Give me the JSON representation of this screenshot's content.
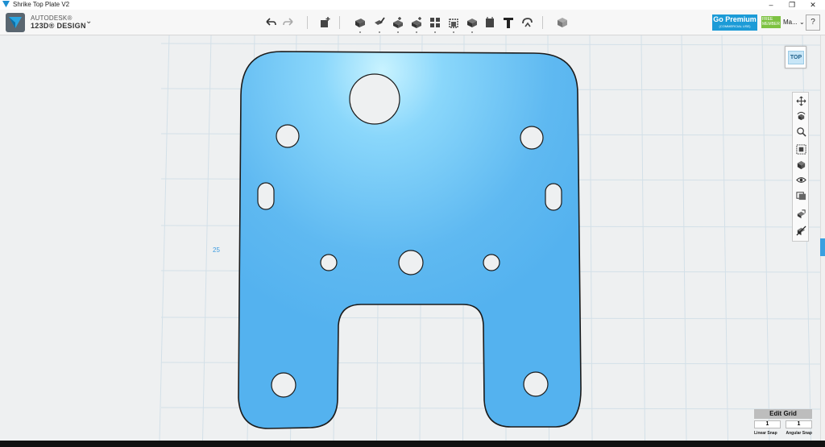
{
  "window": {
    "title": "Shrike Top Plate V2",
    "controls": [
      "–",
      "❐",
      "✕"
    ]
  },
  "brand": {
    "company": "AUTODESK®",
    "product": "123D® DESIGN",
    "caret": "⌄"
  },
  "toolbar": {
    "tools": [
      {
        "name": "undo-icon"
      },
      {
        "name": "redo-icon"
      },
      {
        "name": "transform-icon"
      },
      {
        "name": "primitives-icon"
      },
      {
        "name": "sketch-icon"
      },
      {
        "name": "construct-icon"
      },
      {
        "name": "modify-icon"
      },
      {
        "name": "pattern-icon"
      },
      {
        "name": "grouping-icon"
      },
      {
        "name": "combine-icon"
      },
      {
        "name": "measure-icon"
      },
      {
        "name": "text-icon"
      },
      {
        "name": "snap-icon"
      },
      {
        "name": "material-icon"
      }
    ]
  },
  "premium": {
    "label": "Go Premium",
    "sub": "(COMMERCIAL USE)"
  },
  "member": {
    "badge": "FREE MEMBER",
    "user": "Ma...",
    "caret": "⌄"
  },
  "help": {
    "label": "?"
  },
  "viewport": {
    "grid_label": "25",
    "plate_color": "#5fb9f1",
    "accent": "#3aa0e0"
  },
  "viewcube": {
    "face": "TOP"
  },
  "navbar": {
    "buttons": [
      "pan-icon",
      "orbit-icon",
      "zoom-icon",
      "fit-icon",
      "perspective-icon",
      "visibility-icon",
      "materials-outlines-icon",
      "grid-icon",
      "hide-icon"
    ]
  },
  "edit_grid": {
    "title": "Edit Grid",
    "linear_value": "1",
    "angular_value": "1",
    "linear_label": "Linear Snap",
    "angular_label": "Angular Snap"
  }
}
